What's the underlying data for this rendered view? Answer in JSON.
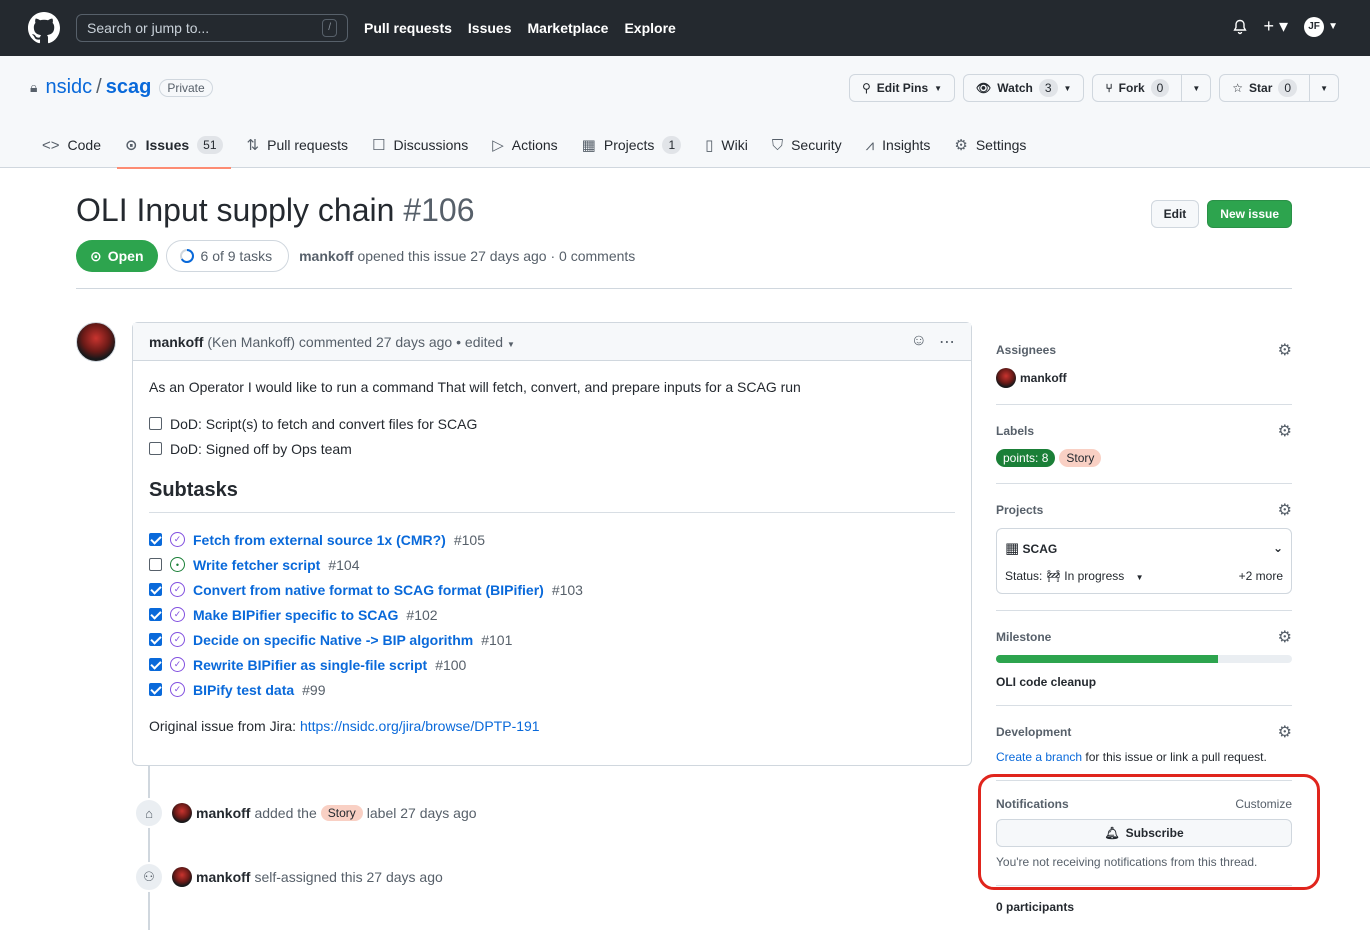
{
  "header": {
    "search_placeholder": "Search or jump to...",
    "slash_key": "/",
    "nav": [
      "Pull requests",
      "Issues",
      "Marketplace",
      "Explore"
    ],
    "avatar_initials": "JF"
  },
  "repo": {
    "owner": "nsidc",
    "name": "scag",
    "visibility": "Private",
    "edit_pins": "Edit Pins",
    "watch": "Watch",
    "watch_count": "3",
    "fork": "Fork",
    "fork_count": "0",
    "star": "Star",
    "star_count": "0"
  },
  "tabs": [
    {
      "label": "Code",
      "icon": "code-icon"
    },
    {
      "label": "Issues",
      "icon": "issue-icon",
      "count": "51"
    },
    {
      "label": "Pull requests",
      "icon": "pull-request-icon"
    },
    {
      "label": "Discussions",
      "icon": "discussions-icon"
    },
    {
      "label": "Actions",
      "icon": "play-icon"
    },
    {
      "label": "Projects",
      "icon": "table-icon",
      "count": "1"
    },
    {
      "label": "Wiki",
      "icon": "book-icon"
    },
    {
      "label": "Security",
      "icon": "shield-icon"
    },
    {
      "label": "Insights",
      "icon": "graph-icon"
    },
    {
      "label": "Settings",
      "icon": "gear-icon"
    }
  ],
  "issue": {
    "title": "OLI Input supply chain",
    "number": "#106",
    "edit_label": "Edit",
    "new_issue_label": "New issue",
    "state": "Open",
    "tasks_progress": "6 of 9 tasks",
    "author": "mankoff",
    "opened_text": "opened this issue 27 days ago · 0 comments"
  },
  "comment": {
    "author": "mankoff",
    "header_rest": "(Ken Mankoff) commented 27 days ago • edited",
    "intro": "As an Operator I would like to run a command That will fetch, convert, and prepare inputs for a SCAG run",
    "dod": [
      {
        "text": "DoD: Script(s) to fetch and convert files for SCAG",
        "checked": false
      },
      {
        "text": "DoD: Signed off by Ops team",
        "checked": false
      }
    ],
    "subtasks_heading": "Subtasks",
    "subtasks": [
      {
        "title": "Fetch from external source 1x (CMR?)",
        "number": "#105",
        "checked": true,
        "state": "closed"
      },
      {
        "title": "Write fetcher script",
        "number": "#104",
        "checked": false,
        "state": "open"
      },
      {
        "title": "Convert from native format to SCAG format (BIPifier)",
        "number": "#103",
        "checked": true,
        "state": "closed"
      },
      {
        "title": "Make BIPifier specific to SCAG",
        "number": "#102",
        "checked": true,
        "state": "closed"
      },
      {
        "title": "Decide on specific Native -> BIP algorithm",
        "number": "#101",
        "checked": true,
        "state": "closed"
      },
      {
        "title": "Rewrite BIPifier as single-file script",
        "number": "#100",
        "checked": true,
        "state": "closed"
      },
      {
        "title": "BIPify test data",
        "number": "#99",
        "checked": true,
        "state": "closed"
      }
    ],
    "origin_prefix": "Original issue from Jira:",
    "origin_link": "https://nsidc.org/jira/browse/DPTP-191"
  },
  "timeline": [
    {
      "actor": "mankoff",
      "pre": "added the",
      "label": "Story",
      "post": "label 27 days ago"
    },
    {
      "actor": "mankoff",
      "pre": "self-assigned this 27 days ago"
    }
  ],
  "sidebar": {
    "assignees_title": "Assignees",
    "assignee": "mankoff",
    "labels_title": "Labels",
    "labels": [
      {
        "name": "points: 8",
        "color": "#1a7f37"
      },
      {
        "name": "Story",
        "color": "#f9d0c4"
      }
    ],
    "projects_title": "Projects",
    "project_name": "SCAG",
    "status_label": "Status:",
    "status_value": "In progress",
    "more": "+2 more",
    "milestone_title": "Milestone",
    "milestone_progress": 0.75,
    "milestone_name": "OLI code cleanup",
    "development_title": "Development",
    "dev_link": "Create a branch",
    "dev_rest": "for this issue or link a pull request.",
    "notifications_title": "Notifications",
    "customize": "Customize",
    "subscribe": "Subscribe",
    "notif_text": "You're not receiving notifications from this thread.",
    "participants": "0 participants"
  },
  "colors": {
    "header_bg": "#24292f",
    "open_green": "#2da44e",
    "link_blue": "#0969da",
    "highlight_red": "#e0251d"
  }
}
